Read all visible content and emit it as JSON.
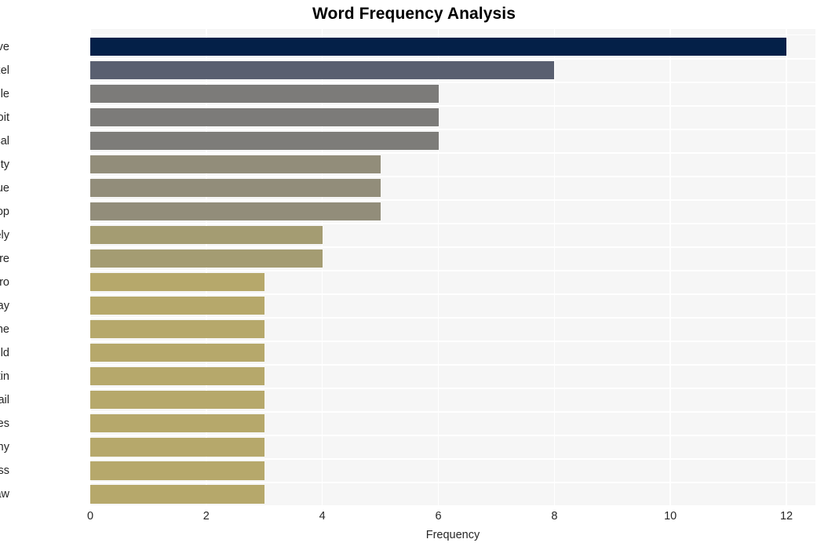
{
  "chart_data": {
    "type": "bar",
    "orientation": "horizontal",
    "title": "Word Frequency Analysis",
    "xlabel": "Frequency",
    "ylabel": "",
    "xlim": [
      0,
      12.5
    ],
    "xticks": [
      0,
      2,
      4,
      6,
      8,
      10,
      12
    ],
    "xtick_labels": [
      "0",
      "2",
      "4",
      "6",
      "8",
      "10",
      "12"
    ],
    "grid": true,
    "legend": null,
    "categories": [
      "cve",
      "pixel",
      "google",
      "exploit",
      "critical",
      "security",
      "issue",
      "eop",
      "actively",
      "firmware",
      "zero",
      "day",
      "june",
      "wild",
      "bulletin",
      "detail",
      "vulnerabilities",
      "company",
      "address",
      "flaw"
    ],
    "values": [
      12,
      8,
      6,
      6,
      6,
      5,
      5,
      5,
      4,
      4,
      3,
      3,
      3,
      3,
      3,
      3,
      3,
      3,
      3,
      3
    ],
    "bar_colors": [
      "#042048",
      "#595f70",
      "#7c7b79",
      "#7c7b79",
      "#7d7c79",
      "#928d7a",
      "#928d7a",
      "#928d7a",
      "#a49c72",
      "#a49c72",
      "#b6a86b",
      "#b6a86b",
      "#b6a86b",
      "#b6a86b",
      "#b6a86b",
      "#b6a86b",
      "#b6a86b",
      "#b6a86b",
      "#b6a86b",
      "#b6a86b"
    ],
    "plot_background": "#f6f6f6",
    "grid_color": "#ffffff",
    "figure_background": "#ffffff",
    "text_color": "#262626",
    "title_color": "#000000"
  }
}
